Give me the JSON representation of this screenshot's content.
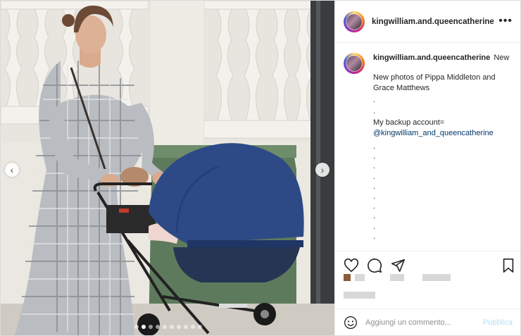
{
  "post": {
    "username": "kingwilliam.and.queencatherine",
    "more_label": "•••"
  },
  "caption": {
    "username": "kingwilliam.and.queencatherine",
    "follow_label": "New",
    "line1": "New photos of Pippa Middleton and Grace Matthews",
    "dot": ".",
    "backup_label": "My backup account=",
    "mention": "@kingwilliam_and_queencatherine",
    "trailing_dots": ".\n.\n.\n.\n.\n.\n.\n.\n.\n."
  },
  "icons": {
    "heart": "heart-icon",
    "comment": "comment-icon",
    "share": "share-icon",
    "save": "bookmark-icon",
    "emoji": "emoji-icon",
    "prev": "chevron-left-icon",
    "next": "chevron-right-icon"
  },
  "nav": {
    "prev": "‹",
    "next": "›"
  },
  "comment_box": {
    "placeholder": "Aggiungi un commento...",
    "publish_label": "Pubblica"
  },
  "colors": {
    "link": "#00376b",
    "publish_disabled": "#b2dffc",
    "stroller_blue": "#2d4a86"
  }
}
